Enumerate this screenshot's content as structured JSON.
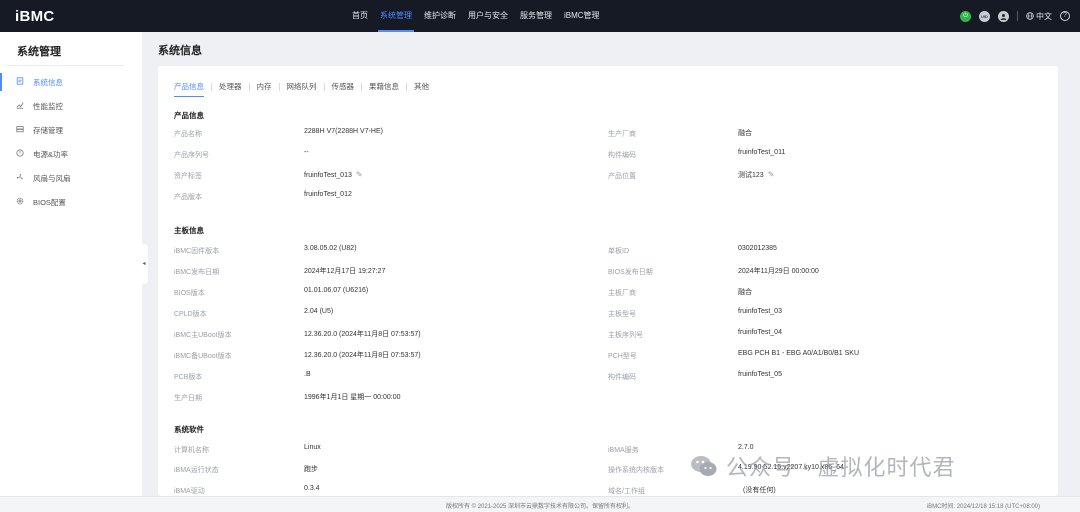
{
  "app": {
    "logo": "iBMC"
  },
  "topnav": [
    {
      "label": "首页",
      "active": false
    },
    {
      "label": "系统管理",
      "active": true
    },
    {
      "label": "维护诊断",
      "active": false
    },
    {
      "label": "用户与安全",
      "active": false
    },
    {
      "label": "服务管理",
      "active": false
    },
    {
      "label": "iBMC管理",
      "active": false
    }
  ],
  "topright": {
    "uid_label": "UID",
    "language": "中文",
    "help_glyph": "?"
  },
  "sidebar": {
    "title": "系统管理",
    "items": [
      {
        "label": "系统信息",
        "icon": "system-info-icon",
        "active": true
      },
      {
        "label": "性能监控",
        "icon": "chart-icon",
        "active": false
      },
      {
        "label": "存储管理",
        "icon": "storage-icon",
        "active": false
      },
      {
        "label": "电源&功率",
        "icon": "power-icon",
        "active": false
      },
      {
        "label": "风扇与风扇",
        "icon": "fan-icon",
        "active": false
      },
      {
        "label": "BIOS配置",
        "icon": "gear-icon",
        "active": false
      }
    ]
  },
  "main": {
    "title": "系统信息",
    "tabs": [
      "产品信息",
      "处理器",
      "内存",
      "网络队列",
      "传感器",
      "果藉信息",
      "其他"
    ],
    "product": {
      "title": "产品信息",
      "left": [
        {
          "label": "产品名称",
          "value": "2288H V7(2288H V7-HE)"
        },
        {
          "label": "产品序列号",
          "value": "--"
        },
        {
          "label": "资产标签",
          "value": "fruinfoTest_013",
          "editable": true
        },
        {
          "label": "产品版本",
          "value": "fruinfoTest_012"
        }
      ],
      "right": [
        {
          "label": "生产厂商",
          "value": "融合"
        },
        {
          "label": "构件编码",
          "value": "fruinfoTest_011"
        },
        {
          "label": "产品位置",
          "value": "测试123",
          "editable": true
        }
      ]
    },
    "board": {
      "title": "主板信息",
      "left": [
        {
          "label": "iBMC固件版本",
          "value": "3.08.05.02 (U82)"
        },
        {
          "label": "iBMC发布日期",
          "value": "2024年12月17日 19:27:27"
        },
        {
          "label": "BIOS版本",
          "value": "01.01.06.07 (U6216)"
        },
        {
          "label": "CPLD版本",
          "value": "2.04  (U5)"
        },
        {
          "label": "iBMC主UBoot版本",
          "value": "12.36.20.0  (2024年11月8日 07:53:57)"
        },
        {
          "label": "iBMC备UBoot版本",
          "value": "12.36.20.0  (2024年11月8日 07:53:57)"
        },
        {
          "label": "PCB版本",
          "value": ".B"
        },
        {
          "label": "生产日期",
          "value": "1996年1月1日 星期一 00:00:00"
        }
      ],
      "right": [
        {
          "label": "单板ID",
          "value": "0302012385"
        },
        {
          "label": "BIOS发布日期",
          "value": "2024年11月29日 00:00:00"
        },
        {
          "label": "主板厂商",
          "value": "融合"
        },
        {
          "label": "主板型号",
          "value": "fruinfoTest_03"
        },
        {
          "label": "主板序列号",
          "value": "fruinfoTest_04"
        },
        {
          "label": "PCH型号",
          "value": "EBG PCH B1 - EBG A0/A1/B0/B1 SKU"
        },
        {
          "label": "构件编码",
          "value": "fruinfoTest_05"
        }
      ]
    },
    "software": {
      "title": "系统软件",
      "left": [
        {
          "label": "计算机名称",
          "value": "Linux"
        },
        {
          "label": "iBMA运行状态",
          "value": "跑步"
        },
        {
          "label": "iBMA驱动",
          "value": "0.3.4"
        }
      ],
      "right": [
        {
          "label": "iBMA服务",
          "value": "2.7.0"
        },
        {
          "label": "操作系统内核版本",
          "value": "4.19.90-52.15.v2207.ky10.x86_64"
        },
        {
          "label": "域名/工作组",
          "value": "(没有任何)"
        }
      ]
    }
  },
  "footer": {
    "copyright": "版权所有 © 2021-2025 深圳市云鼎数字技术有限公司。保留所有权利。",
    "time": "iBMC时间:   2024/12/18 15:18 (UTC+08:00)"
  },
  "watermark": {
    "text": "公众号 · 虚拟化时代君"
  }
}
